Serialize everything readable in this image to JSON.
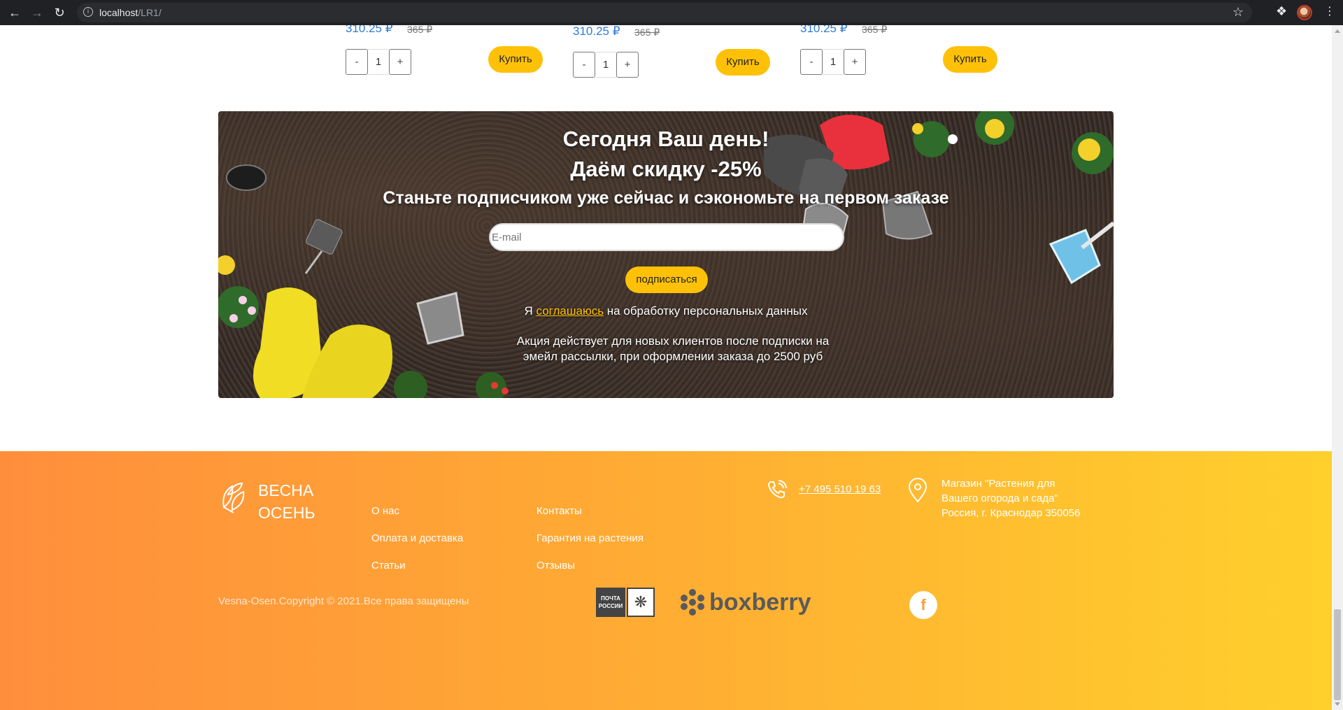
{
  "browser": {
    "url_host": "localhost",
    "url_path": "/LR1/"
  },
  "products": [
    {
      "price": "310.25 ₽",
      "old_price": "365 ₽",
      "qty_minus": "-",
      "qty": "1",
      "qty_plus": "+",
      "buy_label": "Купить"
    },
    {
      "price": "310.25 ₽",
      "old_price": "365 ₽",
      "qty_minus": "-",
      "qty": "1",
      "qty_plus": "+",
      "buy_label": "Купить"
    },
    {
      "price": "310.25 ₽",
      "old_price": "365 ₽",
      "qty_minus": "-",
      "qty": "1",
      "qty_plus": "+",
      "buy_label": "Купить"
    }
  ],
  "promo": {
    "title_line1": "Сегодня Ваш день!",
    "title_line2": "Даём скидку -25%",
    "subtitle": "Станьте подписчиком уже сейчас и сэкономьте на первом заказе",
    "email_placeholder": "E-mail",
    "subscribe_label": "подписаться",
    "consent_prefix": "Я",
    "consent_link": "соглашаюсь",
    "consent_suffix": "на обработку персональных данных",
    "note": "Акция действует для новых клиентов после подписки на эмейл рассылки, при оформлении заказа до 2500 руб"
  },
  "footer": {
    "logo_line1": "ВЕСНА",
    "logo_line2": "ОСЕНЬ",
    "links_col1": [
      "О нас",
      "Оплата и доставка",
      "Статьи"
    ],
    "links_col2": [
      "Контакты",
      "Гарантия на растения",
      "Отзывы"
    ],
    "phone": "+7 495 510 19 63",
    "address_line1": "Магазин \"Растения для",
    "address_line2": "Вашего огорода и сада\"",
    "address_line3": "Россия, г. Краснодар 350056",
    "copyright": "Vesna-Osen.Copyright © 2021.Все права защищены",
    "pochta_label": "ПОЧТА РОССИИ",
    "boxberry_label": "boxberry",
    "facebook_icon_glyph": "f",
    "colors": {
      "gradient_start": "#ff8e3c",
      "gradient_end": "#ffd02c"
    }
  }
}
